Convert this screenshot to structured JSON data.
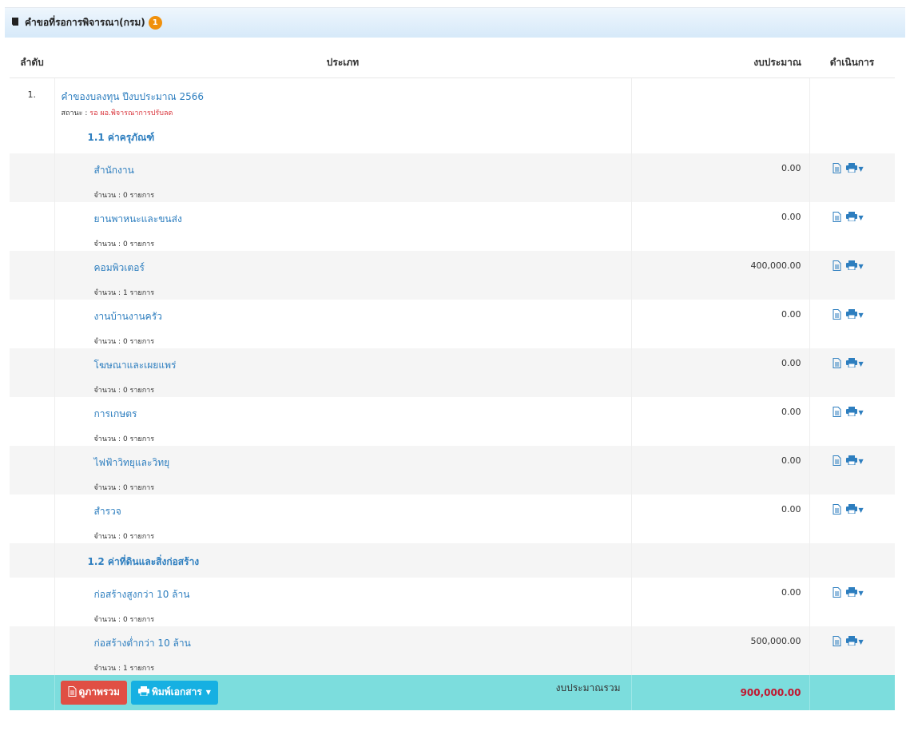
{
  "panel": {
    "title": "คำขอที่รอการพิจารณา(กรม)",
    "badge": "1"
  },
  "table": {
    "headers": {
      "no": "ลำดับ",
      "type": "ประเภท",
      "budget": "งบประมาณ",
      "action": "ดำเนินการ"
    },
    "project": {
      "no": "1.",
      "title": "คำของบลงทุน ปีงบประมาณ 2566",
      "status_label": "สถานะ : ",
      "status_value": "รอ ผอ.พิจารณาการปรับลด"
    },
    "groups": [
      {
        "name": "1.1 ค่าครุภัณฑ์"
      },
      {
        "name": "1.2 ค่าที่ดินและสิ่งก่อสร้าง"
      }
    ],
    "items": [
      {
        "name": "สำนักงาน",
        "count": "จำนวน : 0 รายการ",
        "amount": "0.00"
      },
      {
        "name": "ยานพาหนะและขนส่ง",
        "count": "จำนวน : 0 รายการ",
        "amount": "0.00"
      },
      {
        "name": "คอมพิวเตอร์",
        "count": "จำนวน : 1 รายการ",
        "amount": "400,000.00"
      },
      {
        "name": "งานบ้านงานครัว",
        "count": "จำนวน : 0 รายการ",
        "amount": "0.00"
      },
      {
        "name": "โฆษณาและเผยแพร่",
        "count": "จำนวน : 0 รายการ",
        "amount": "0.00"
      },
      {
        "name": "การเกษตร",
        "count": "จำนวน : 0 รายการ",
        "amount": "0.00"
      },
      {
        "name": "ไฟฟ้าวิทยุและวิทยุ",
        "count": "จำนวน : 0 รายการ",
        "amount": "0.00"
      },
      {
        "name": "สำรวจ",
        "count": "จำนวน : 0 รายการ",
        "amount": "0.00"
      },
      {
        "name": "ก่อสร้างสูงกว่า 10 ล้าน",
        "count": "จำนวน : 0 รายการ",
        "amount": "0.00"
      },
      {
        "name": "ก่อสร้างต่ำกว่า 10 ล้าน",
        "count": "จำนวน : 1 รายการ",
        "amount": "500,000.00"
      }
    ],
    "footer": {
      "overview_button": "ดูภาพรวม",
      "print_button": "พิมพ์เอกสาร",
      "total_label": "งบประมาณรวม",
      "total_value": "900,000.00"
    }
  },
  "colors": {
    "link": "#2d7ebf",
    "footer_bg": "#7cdddd",
    "total": "#c0172f",
    "badge": "#f0900c"
  }
}
